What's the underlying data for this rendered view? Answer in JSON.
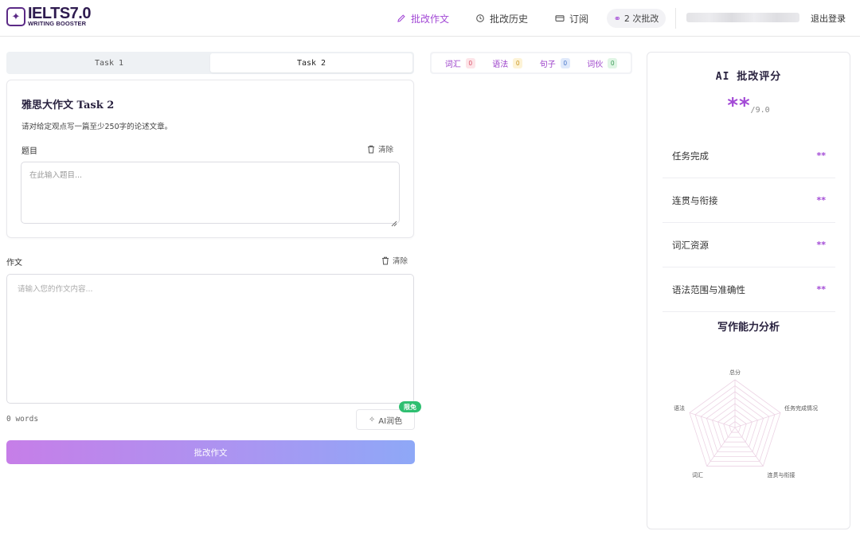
{
  "header": {
    "logo_title": "IELTS7.0",
    "logo_sub": "WRITING BOOSTER",
    "nav": [
      {
        "label": "批改作文",
        "icon": "pencil-icon",
        "active": true
      },
      {
        "label": "批改历史",
        "icon": "history-icon",
        "active": false
      },
      {
        "label": "订阅",
        "icon": "card-icon",
        "active": false
      }
    ],
    "credits": "2 次批改",
    "logout": "退出登录"
  },
  "task_tabs": [
    {
      "label": "Task 1",
      "active": false
    },
    {
      "label": "Task 2",
      "active": true
    }
  ],
  "prompt": {
    "title": "雅思大作文 Task 2",
    "description": "请对给定观点写一篇至少250字的论述文章。",
    "topic_label": "题目",
    "clear_label": "清除",
    "topic_placeholder": "在此输入题目..."
  },
  "essay": {
    "label": "作文",
    "clear_label": "清除",
    "placeholder": "请输入您的作文内容...",
    "word_count": "0 words",
    "polish_label": "AI润色",
    "free_badge": "限免",
    "submit_label": "批改作文"
  },
  "categories": [
    {
      "label": "词汇",
      "count": "0",
      "badge_bg": "#fde4e8",
      "badge_fg": "#d9536a"
    },
    {
      "label": "语法",
      "count": "0",
      "badge_bg": "#fdf3d6",
      "badge_fg": "#c99520"
    },
    {
      "label": "句子",
      "count": "0",
      "badge_bg": "#dfe9fb",
      "badge_fg": "#4a77c9"
    },
    {
      "label": "词伙",
      "count": "0",
      "badge_bg": "#dff5e4",
      "badge_fg": "#3a9a57"
    }
  ],
  "score_panel": {
    "title": "AI 批改评分",
    "overall": "**",
    "max": "/9.0",
    "criteria": [
      {
        "name": "任务完成",
        "score": "**"
      },
      {
        "name": "连贯与衔接",
        "score": "**"
      },
      {
        "name": "词汇资源",
        "score": "**"
      },
      {
        "name": "语法范围与准确性",
        "score": "**"
      }
    ],
    "analysis_title": "写作能力分析",
    "radar_labels": [
      "总分",
      "任务完成情况",
      "连贯与衔接",
      "词汇",
      "语法"
    ]
  },
  "colors": {
    "accent": "#a34ad6",
    "brand_dark": "#2e1b4f",
    "submit_gradient_start": "#c67ee8",
    "submit_gradient_end": "#8ea8f7",
    "free_badge": "#2fbf71"
  }
}
